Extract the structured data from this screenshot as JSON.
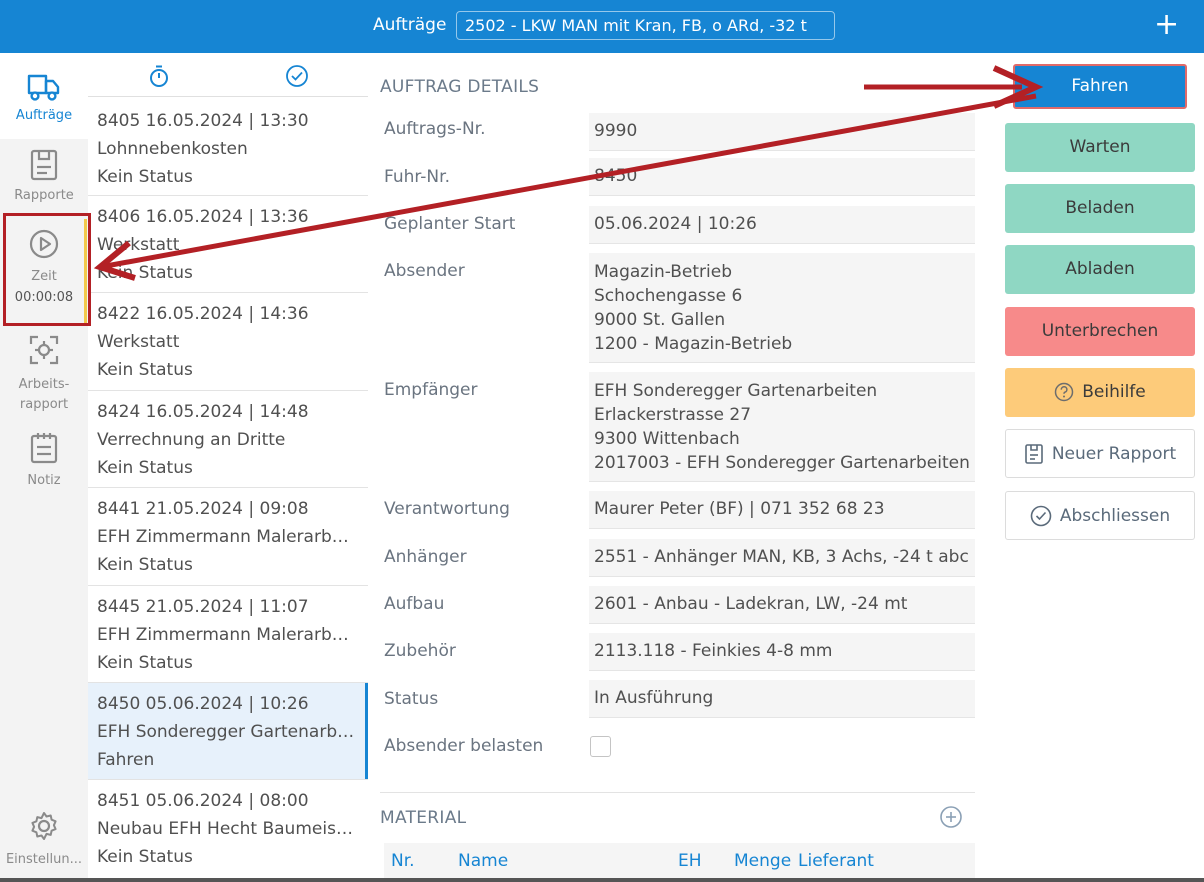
{
  "header": {
    "label": "Aufträge",
    "vehicle": "2502 - LKW MAN mit Kran, FB, o ARd, -32 t",
    "add_symbol": "+"
  },
  "nav": {
    "items": [
      {
        "label": "Aufträge",
        "icon": "truck-icon"
      },
      {
        "label": "Rapporte",
        "icon": "report-icon"
      },
      {
        "label": "Zeit",
        "icon": "play-circle-icon",
        "time": "00:00:08"
      },
      {
        "label_line1": "Arbeits-",
        "label_line2": "rapport",
        "icon": "focus-icon"
      },
      {
        "label": "Notiz",
        "icon": "clipboard-icon"
      },
      {
        "label": "Einstellun...",
        "icon": "gear-icon"
      }
    ]
  },
  "orders": [
    {
      "line1": "8405  16.05.2024 | 13:30",
      "line2": "Lohnnebenkosten",
      "line3": "Kein Status"
    },
    {
      "line1": "8406  16.05.2024 | 13:36",
      "line2": "Werkstatt",
      "line3": "Kein Status"
    },
    {
      "line1": "8422  16.05.2024 | 14:36",
      "line2": "Werkstatt",
      "line3": "Kein Status"
    },
    {
      "line1": "8424  16.05.2024 | 14:48",
      "line2": "Verrechnung an Dritte",
      "line3": "Kein Status"
    },
    {
      "line1": "8441  21.05.2024 | 09:08",
      "line2": "EFH Zimmermann Malerarbeiten",
      "line3": "Kein Status"
    },
    {
      "line1": "8445  21.05.2024 | 11:07",
      "line2": "EFH Zimmermann Malerarbeiten",
      "line3": "Kein Status"
    },
    {
      "line1": "8450  05.06.2024 | 10:26",
      "line2": "EFH Sonderegger Gartenarbeiten",
      "line3": "Fahren"
    },
    {
      "line1": "8451  05.06.2024 | 08:00",
      "line2": "Neubau EFH Hecht Baumeister",
      "line3": "Kein Status"
    }
  ],
  "details": {
    "section_title": "AUFTRAG DETAILS",
    "fields": [
      {
        "label": "Auftrags-Nr.",
        "value": "9990"
      },
      {
        "label": "Fuhr-Nr.",
        "value": "8450"
      },
      {
        "label": "Geplanter Start",
        "value": "05.06.2024 | 10:26"
      },
      {
        "label": "Absender",
        "lines": [
          "Magazin-Betrieb",
          "Schochengasse 6",
          "9000 St. Gallen",
          "1200 - Magazin-Betrieb"
        ]
      },
      {
        "label": "Empfänger",
        "lines": [
          "EFH Sonderegger Gartenarbeiten",
          "Erlackerstrasse 27",
          "9300 Wittenbach",
          "2017003 - EFH Sonderegger Gartenarbeiten"
        ]
      },
      {
        "label": "Verantwortung",
        "value": "Maurer Peter (BF) | 071 352 68 23"
      },
      {
        "label": "Anhänger",
        "value": "2551 - Anhänger MAN, KB, 3 Achs, -24 t abc"
      },
      {
        "label": "Aufbau",
        "value": "2601 - Anbau - Ladekran, LW, -24 mt"
      },
      {
        "label": "Zubehör",
        "value": "2113.118 - Feinkies 4-8 mm"
      },
      {
        "label": "Status",
        "value": "In Ausführung"
      },
      {
        "label": "Absender belasten"
      }
    ],
    "material_title": "MATERIAL",
    "material_columns": [
      "Nr.",
      "Name",
      "EH",
      "Menge",
      "Lieferant"
    ]
  },
  "actions": {
    "fahren": "Fahren",
    "warten": "Warten",
    "beladen": "Beladen",
    "abladen": "Abladen",
    "unterbrechen": "Unterbrechen",
    "beihilfe": "Beihilfe",
    "neuer_rapport": "Neuer Rapport",
    "abschliessen": "Abschliessen"
  },
  "colors": {
    "brand_blue": "#1685d3",
    "action_green": "#8fd7c3",
    "action_red": "#f78a8a",
    "action_yellow": "#fdcb7a",
    "annotation_red": "#b32025"
  }
}
